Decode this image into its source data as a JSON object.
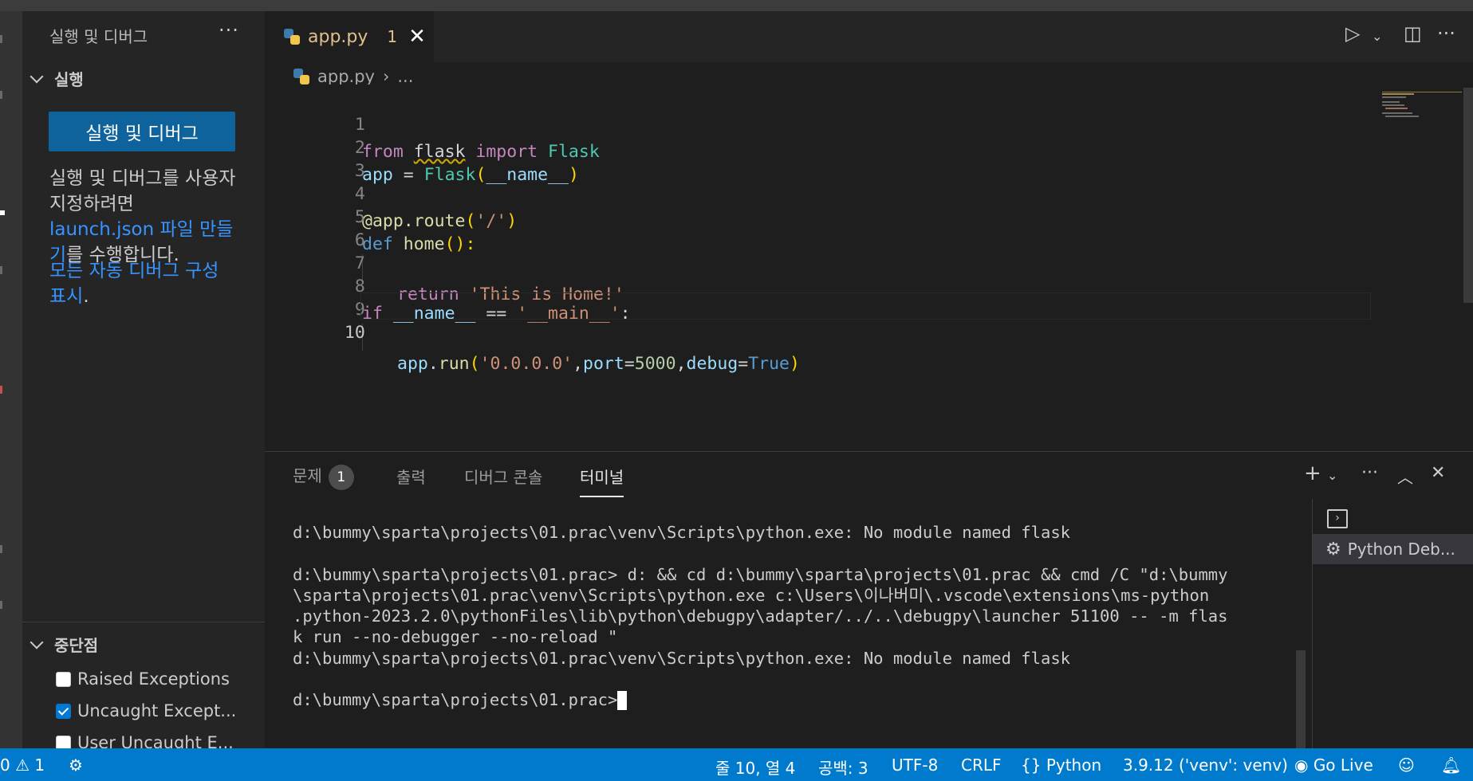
{
  "sidebar": {
    "title": "실행 및 디버그",
    "more": "···",
    "run_section": "실행",
    "run_button": "실행 및 디버그",
    "desc_before": "실행 및 디버그를 사용자 지정하려면 ",
    "desc_link": "launch.json 파일 만들기",
    "desc_after": "를 수행합니다.",
    "auto_link": "모든 자동 디버그 구성 표시",
    "auto_after": ".",
    "breakpoints_section": "중단점",
    "breakpoints": [
      {
        "label": "Raised Exceptions",
        "checked": false
      },
      {
        "label": "Uncaught Except...",
        "checked": true
      },
      {
        "label": "User Uncaught E...",
        "checked": false
      }
    ]
  },
  "editor": {
    "tab_name": "app.py",
    "tab_problem_count": "1",
    "breadcrumb_file": "app.py",
    "breadcrumb_rest": "...",
    "line_numbers": [
      "1",
      "2",
      "3",
      "4",
      "5",
      "6",
      "7",
      "8",
      "9",
      "10"
    ],
    "tokens": {
      "l1": [
        "from",
        "flask",
        "import",
        "Flask"
      ],
      "l2": [
        "app",
        "=",
        "Flask",
        "(",
        "__name__",
        ")"
      ],
      "l4": [
        "@app.route",
        "(",
        "'/'",
        ")"
      ],
      "l5": [
        "def",
        "home",
        "():"
      ],
      "l6": [
        "return",
        "'This is Home!'"
      ],
      "l8": [
        "if",
        "__name__",
        "==",
        "'__main__'",
        ":"
      ],
      "l9": [
        "app",
        ".",
        "run",
        "(",
        "'0.0.0.0'",
        ",",
        "port",
        "=",
        "5000",
        ",",
        "debug",
        "=",
        "True",
        ")"
      ]
    }
  },
  "panel": {
    "tabs": [
      {
        "label": "문제",
        "badge": "1"
      },
      {
        "label": "출력"
      },
      {
        "label": "디버그 콘솔"
      },
      {
        "label": "터미널"
      }
    ],
    "terminal_lines": [
      "d:\\bummy\\sparta\\projects\\01.prac\\venv\\Scripts\\python.exe: No module named flask",
      "",
      "d:\\bummy\\sparta\\projects\\01.prac> d: && cd d:\\bummy\\sparta\\projects\\01.prac && cmd /C \"d:\\bummy",
      "\\sparta\\projects\\01.prac\\venv\\Scripts\\python.exe c:\\Users\\이나버미\\.vscode\\extensions\\ms-python",
      ".python-2023.2.0\\pythonFiles\\lib\\python\\debugpy\\adapter/../..\\debugpy\\launcher 51100 -- -m flas",
      "k run --no-debugger --no-reload \"",
      "d:\\bummy\\sparta\\projects\\01.prac\\venv\\Scripts\\python.exe: No module named flask",
      ""
    ],
    "prompt": "d:\\bummy\\sparta\\projects\\01.prac>",
    "terminal_session": "Python Deb..."
  },
  "statusbar": {
    "errors": "0",
    "warnings": "1",
    "position": "줄 10, 열 4",
    "spaces": "공백: 3",
    "encoding": "UTF-8",
    "eol": "CRLF",
    "language": "Python",
    "interpreter": "3.9.12 ('venv': venv)",
    "golive": "Go Live"
  },
  "colors": {
    "accent": "#007acc",
    "button": "#0e639c",
    "link": "#3794ff",
    "modified_tab": "#e2c08d"
  }
}
